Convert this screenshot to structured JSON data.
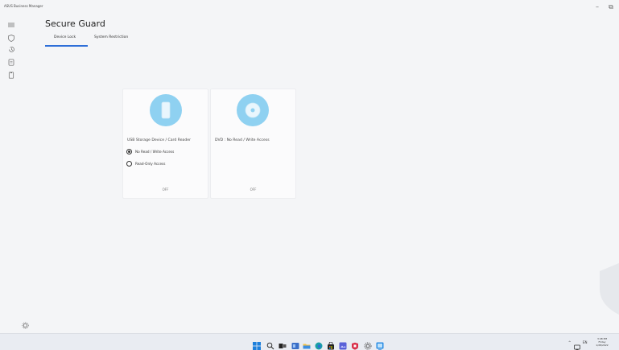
{
  "window": {
    "app_title": "ASUS Business Manager",
    "minimize_glyph": "–",
    "restore_glyph": "⧉"
  },
  "sidebar": {
    "items": [
      {
        "icon": "menu-icon"
      },
      {
        "icon": "shield-icon"
      },
      {
        "icon": "history-icon"
      },
      {
        "icon": "document-icon"
      },
      {
        "icon": "clipboard-icon"
      }
    ],
    "settings_icon": "gear-icon"
  },
  "page": {
    "title": "Secure Guard",
    "tabs": [
      {
        "label": "Device Lock",
        "active": true
      },
      {
        "label": "System Restriction",
        "active": false
      }
    ]
  },
  "cards": [
    {
      "icon": "usb-storage-icon",
      "label": "USB Storage Device / Card Reader",
      "options": [
        {
          "label": "No Read / Write Access",
          "checked": true
        },
        {
          "label": "Read-Only Access",
          "checked": false
        }
      ],
      "status": "OFF"
    },
    {
      "icon": "dvd-disc-icon",
      "label": "DVD : No Read / Write Access",
      "status": "OFF"
    }
  ],
  "taskbar": {
    "icons": [
      "windows-start-icon",
      "search-icon",
      "task-view-icon",
      "widgets-icon",
      "file-explorer-icon",
      "edge-icon",
      "store-icon",
      "photos-icon",
      "app-icon",
      "settings-icon",
      "asus-manager-icon"
    ],
    "tray": {
      "chevron": "^",
      "lang": "EN",
      "time": "3:48 PM",
      "day": "Friday",
      "date": "1/28/2022"
    }
  },
  "colors": {
    "accent": "#2e6fd8",
    "card_icon": "#8fd1f1",
    "background": "#f4f5f7"
  }
}
